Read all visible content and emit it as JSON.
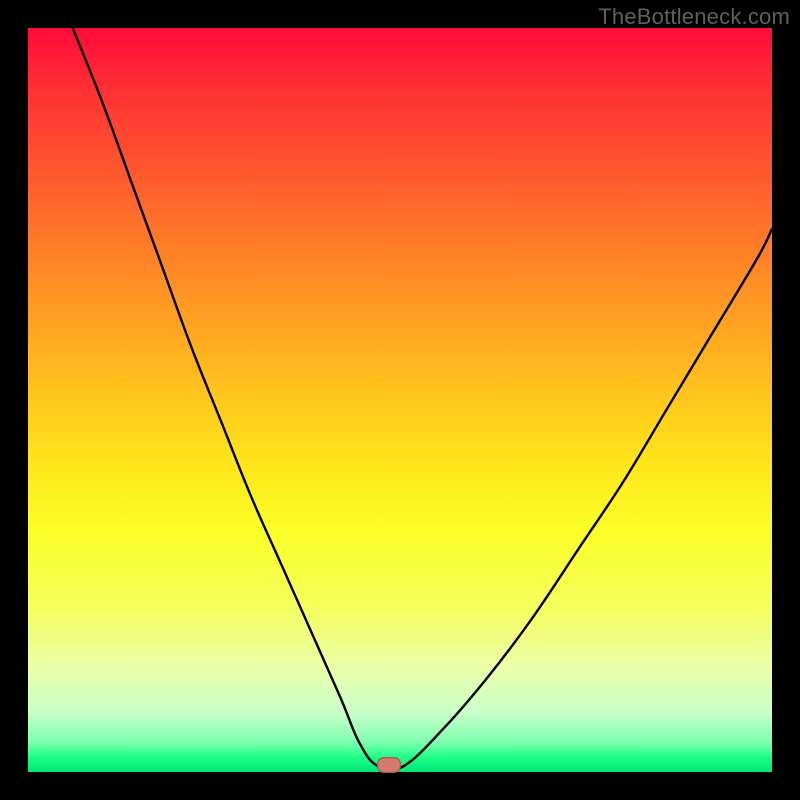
{
  "watermark": "TheBottleneck.com",
  "marker": {
    "x_pct": 48.5,
    "y_pct": 99.0,
    "color": "#d67a70"
  },
  "chart_data": {
    "type": "line",
    "title": "",
    "xlabel": "",
    "ylabel": "",
    "xlim": [
      0,
      100
    ],
    "ylim": [
      0,
      100
    ],
    "grid": false,
    "legend": null,
    "background": "rainbow-vertical-gradient",
    "annotations": [
      {
        "text": "TheBottleneck.com",
        "pos": "top-right",
        "color": "#5f5f5f"
      }
    ],
    "marker_point": {
      "x": 48.5,
      "y": 0
    },
    "series": [
      {
        "name": "left-branch",
        "x": [
          6,
          10,
          14,
          18,
          22,
          26,
          30,
          34,
          38,
          42,
          44.5,
          47
        ],
        "y": [
          100,
          90,
          79,
          68,
          57,
          47,
          37,
          28,
          19,
          10,
          4,
          0.8
        ]
      },
      {
        "name": "valley-floor",
        "x": [
          47,
          50.5
        ],
        "y": [
          0.8,
          0.8
        ]
      },
      {
        "name": "right-branch",
        "x": [
          50.5,
          56,
          62,
          68,
          74,
          80,
          86,
          92,
          98,
          100
        ],
        "y": [
          0.8,
          6,
          13,
          21,
          30,
          39,
          49,
          59,
          69,
          73
        ]
      }
    ]
  }
}
